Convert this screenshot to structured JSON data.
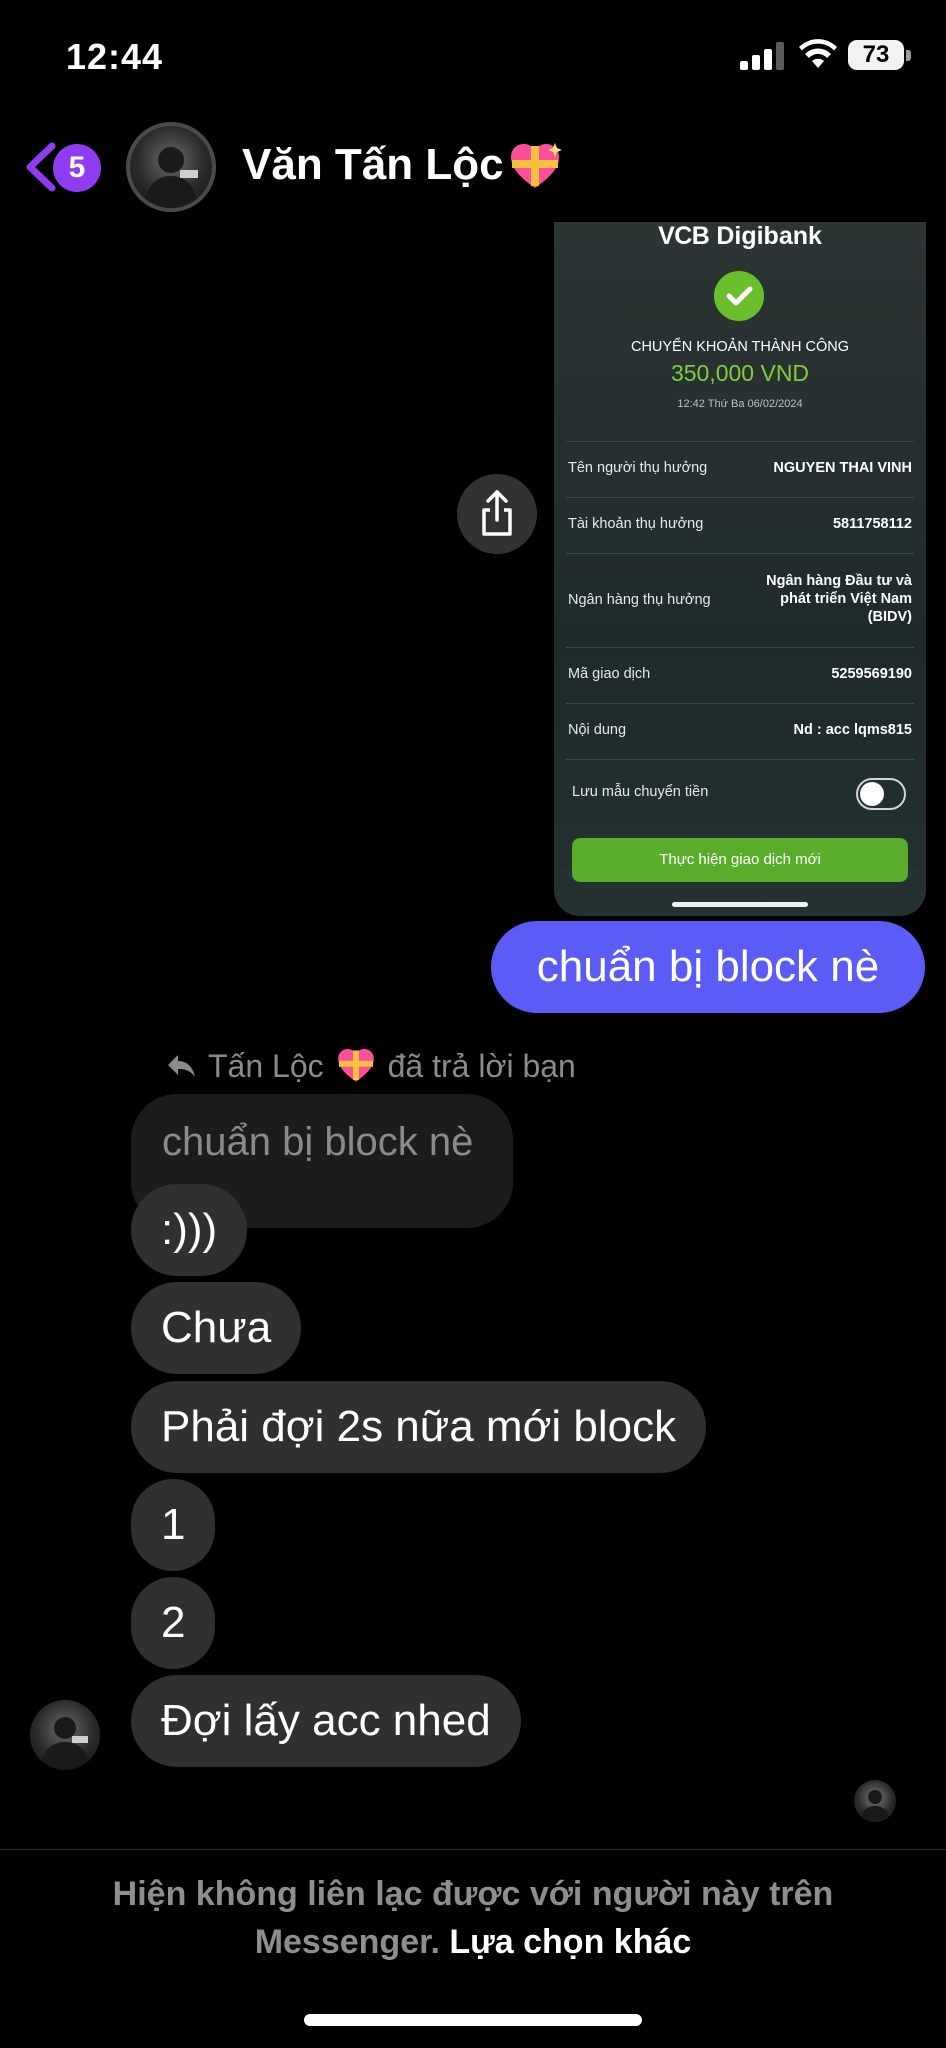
{
  "status_bar": {
    "time": "12:44",
    "battery": "73"
  },
  "header": {
    "unread_count": "5",
    "contact_name": "Văn Tấn Lộc"
  },
  "receipt": {
    "brand": "VCB",
    "brand_suffix": "Digibank",
    "status": "CHUYỂN KHOẢN THÀNH CÔNG",
    "amount": "350,000 VND",
    "timestamp": "12:42 Thứ Ba 06/02/2024",
    "rows": [
      {
        "label": "Tên người thụ hưởng",
        "value": "NGUYEN THAI VINH"
      },
      {
        "label": "Tài khoản thụ hưởng",
        "value": "5811758112"
      },
      {
        "label": "Ngân hàng thụ hưởng",
        "value": "Ngân hàng  Đầu tư và phát triển Việt Nam (BIDV)"
      },
      {
        "label": "Mã giao dịch",
        "value": "5259569190"
      },
      {
        "label": "Nội dung",
        "value": "Nd : acc lqms815"
      }
    ],
    "save_template_label": "Lưu mẫu chuyển tiền",
    "save_template_on": false,
    "new_transaction_label": "Thực hiện giao dịch mới"
  },
  "messages": {
    "outgoing": "chuẩn bị block nè",
    "reply_sender": "Tấn Lộc",
    "reply_text": "đã trả lời bạn",
    "quoted": "chuẩn bị block nè",
    "incoming": [
      ":)))",
      "Chưa",
      "Phải đợi 2s nữa mới block",
      "1",
      "2",
      "Đợi lấy acc nhed"
    ]
  },
  "footer": {
    "notice": "Hiện không liên lạc được với người này trên",
    "notice_2": "Messenger.",
    "link": "Lựa chọn khác"
  },
  "colors": {
    "outgoing_bubble": "#5b5cf6",
    "incoming_bubble": "#303030",
    "badge": "#8f3bf2",
    "receipt_green": "#5aad2b"
  }
}
